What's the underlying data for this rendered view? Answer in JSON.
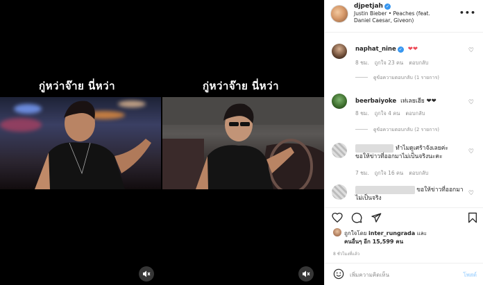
{
  "post": {
    "username": "djpetjah",
    "verified": true,
    "song": "Justin Bieber • Peaches (feat. Daniel Caesar, Giveon)",
    "more_label": "•••"
  },
  "video": {
    "caption_left": "กู่หว่าจ๊าย นี่หว่า",
    "caption_right": "กู่หว่าจ๊าย นี่หว่า"
  },
  "comments": [
    {
      "username": "naphat_nine",
      "verified": true,
      "text": "❤❤",
      "time": "8 ชม.",
      "likes": "ถูกใจ 23 คน",
      "reply": "ตอบกลับ",
      "view_replies": "ดูข้อความตอบกลับ (1 รายการ)"
    },
    {
      "username": "beerbaiyoke",
      "verified": false,
      "text": "เท่เลยเฮีย ❤❤",
      "time": "8 ชม.",
      "likes": "ถูกใจ 4 คน",
      "reply": "ตอบกลับ",
      "view_replies": "ดูข้อความตอบกลับ (2 รายการ)"
    },
    {
      "username": "",
      "verified": false,
      "text_line1": "ทำไมดูเศร้าจังเลยค่ะ",
      "text_line2": "ขอให้ข่าวที่ออกมาไม่เป็นจริงนะคะ",
      "time": "7 ชม.",
      "likes": "ถูกใจ 16 คน",
      "reply": "ตอบกลับ"
    },
    {
      "username": "",
      "verified": false,
      "text_line1": "ขอให้ข่าวที่ออกมา",
      "text_line2": "ไม่เป็นจริง"
    }
  ],
  "likes": {
    "line1_prefix": "ถูกใจโดย",
    "liker": "inter_rungrada",
    "line1_suffix": "และ",
    "line2": "คนอื่นๆ อีก 15,599 คน",
    "time": "8 ชั่วโมงที่แล้ว"
  },
  "add_comment": {
    "placeholder": "เพิ่มความคิดเห็น",
    "post_label": "โพสต์"
  },
  "icons": {
    "heart": "heart-icon",
    "comment": "comment-icon",
    "share": "paper-plane-icon",
    "save": "bookmark-icon",
    "emoji": "smiley-icon",
    "mute": "muted-speaker-icon"
  },
  "colors": {
    "heart_red": "#ed4956",
    "verified_blue": "#3897f0",
    "meta_gray": "#8e8e8e",
    "post_button": "#b3dbff"
  }
}
